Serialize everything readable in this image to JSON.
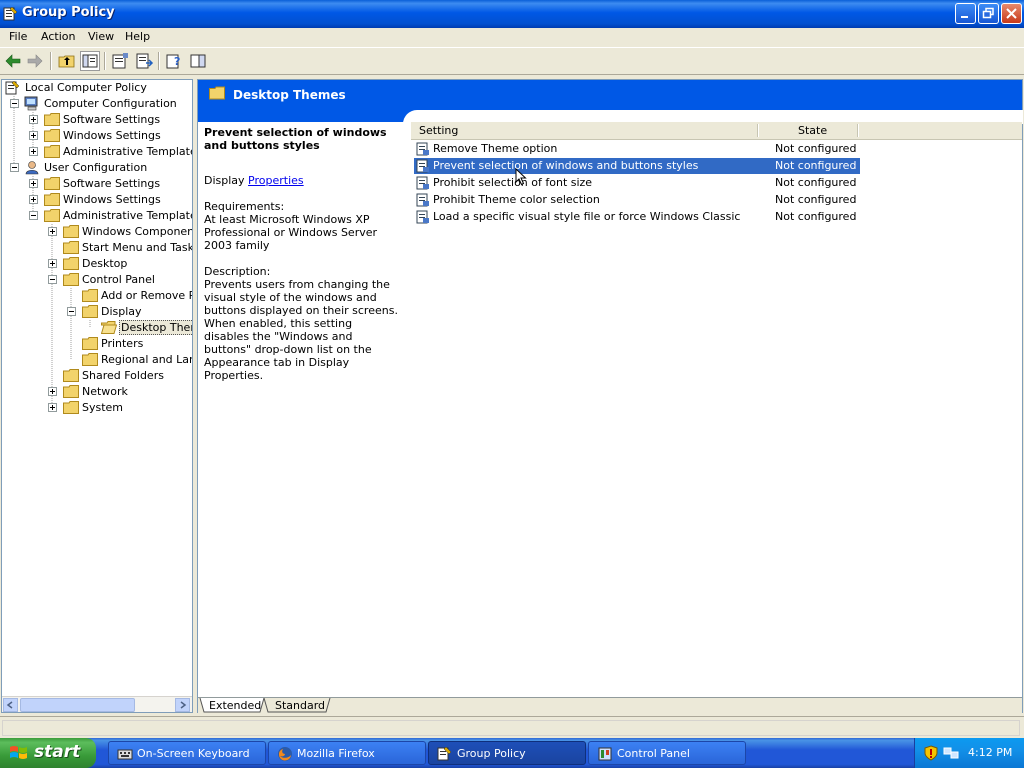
{
  "window": {
    "title": "Group Policy"
  },
  "menu": [
    "File",
    "Action",
    "View",
    "Help"
  ],
  "tree": [
    {
      "label": "Local Computer Policy",
      "icon": "policy-icon"
    },
    {
      "label": "Computer Configuration",
      "icon": "computer-icon"
    },
    {
      "label": "Software Settings",
      "icon": "folder-icon"
    },
    {
      "label": "Windows Settings",
      "icon": "folder-icon"
    },
    {
      "label": "Administrative Templates",
      "icon": "folder-icon"
    },
    {
      "label": "User Configuration",
      "icon": "user-icon"
    },
    {
      "label": "Software Settings",
      "icon": "folder-icon"
    },
    {
      "label": "Windows Settings",
      "icon": "folder-icon"
    },
    {
      "label": "Administrative Templates",
      "icon": "folder-icon"
    },
    {
      "label": "Windows Components",
      "icon": "folder-icon"
    },
    {
      "label": "Start Menu and Taskba",
      "icon": "folder-icon"
    },
    {
      "label": "Desktop",
      "icon": "folder-icon"
    },
    {
      "label": "Control Panel",
      "icon": "folder-icon"
    },
    {
      "label": "Add or Remove Pro",
      "icon": "folder-icon"
    },
    {
      "label": "Display",
      "icon": "folder-icon"
    },
    {
      "label": "Desktop Theme",
      "icon": "folder-open-icon",
      "selected": true
    },
    {
      "label": "Printers",
      "icon": "folder-icon"
    },
    {
      "label": "Regional and Langu",
      "icon": "folder-icon"
    },
    {
      "label": "Shared Folders",
      "icon": "folder-icon"
    },
    {
      "label": "Network",
      "icon": "folder-icon"
    },
    {
      "label": "System",
      "icon": "folder-icon"
    }
  ],
  "details": {
    "header_title": "Desktop Themes",
    "description": {
      "title": "Prevent selection of windows and buttons styles",
      "display_prefix": "Display",
      "properties_link": "Properties",
      "requirements_label": "Requirements:",
      "requirements_text": "At least Microsoft Windows XP Professional or Windows Server 2003 family",
      "description_label": "Description:",
      "description_text": "Prevents users from changing the visual style of the windows and buttons displayed on their screens. When enabled, this setting disables the \"Windows and buttons\" drop-down list on the Appearance tab in Display Properties."
    },
    "columns": {
      "setting": "Setting",
      "state": "State"
    },
    "settings": [
      {
        "name": "Remove Theme option",
        "state": "Not configured",
        "selected": false
      },
      {
        "name": "Prevent selection of windows and buttons styles",
        "state": "Not configured",
        "selected": true
      },
      {
        "name": "Prohibit selection of font size",
        "state": "Not configured",
        "selected": false
      },
      {
        "name": "Prohibit Theme color selection",
        "state": "Not configured",
        "selected": false
      },
      {
        "name": "Load a specific visual style file or force Windows Classic",
        "state": "Not configured",
        "selected": false
      }
    ],
    "tabs": [
      {
        "label": "Extended",
        "active": true
      },
      {
        "label": "Standard",
        "active": false
      }
    ]
  },
  "taskbar": {
    "start_label": "start",
    "tasks": [
      {
        "label": "On-Screen Keyboard",
        "icon": "keyboard-icon",
        "active": false
      },
      {
        "label": "Mozilla Firefox",
        "icon": "firefox-icon",
        "active": false
      },
      {
        "label": "Group Policy",
        "icon": "policy-icon",
        "active": true
      },
      {
        "label": "Control Panel",
        "icon": "control-panel-icon",
        "active": false
      }
    ],
    "clock": "4:12 PM"
  },
  "colors": {
    "title_bar": "#0058e6",
    "selection": "#316ac5",
    "taskbar": "#2157d7",
    "start_button": "#3c9c3c"
  }
}
